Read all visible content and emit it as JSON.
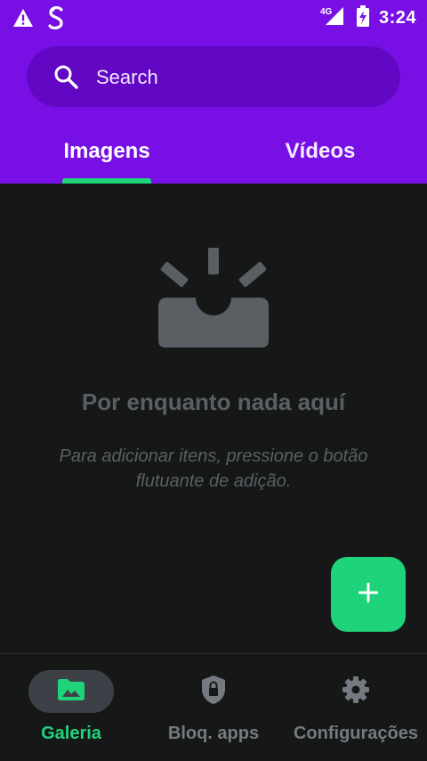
{
  "colors": {
    "header": "#7810e6",
    "search_bg": "#6208c4",
    "accent": "#1fd37b",
    "background": "#161818",
    "muted": "#5b5f63"
  },
  "status_bar": {
    "time": "3:24",
    "network": "4G",
    "icons": [
      "warning-icon",
      "app-s-icon",
      "signal-icon",
      "battery-charging-icon"
    ]
  },
  "search": {
    "placeholder": "Search"
  },
  "tabs": [
    {
      "label": "Imagens",
      "selected": true
    },
    {
      "label": "Vídeos",
      "selected": false
    }
  ],
  "empty_state": {
    "title": "Por enquanto nada aquí",
    "description": "Para adicionar itens, pressione o botão flutuante de adição."
  },
  "fab": {
    "icon": "plus-icon"
  },
  "bottom_nav": [
    {
      "label": "Galeria",
      "icon": "image-folder-icon",
      "active": true
    },
    {
      "label": "Bloq. apps",
      "icon": "lock-shield-icon",
      "active": false
    },
    {
      "label": "Configurações",
      "icon": "gear-icon",
      "active": false
    }
  ]
}
